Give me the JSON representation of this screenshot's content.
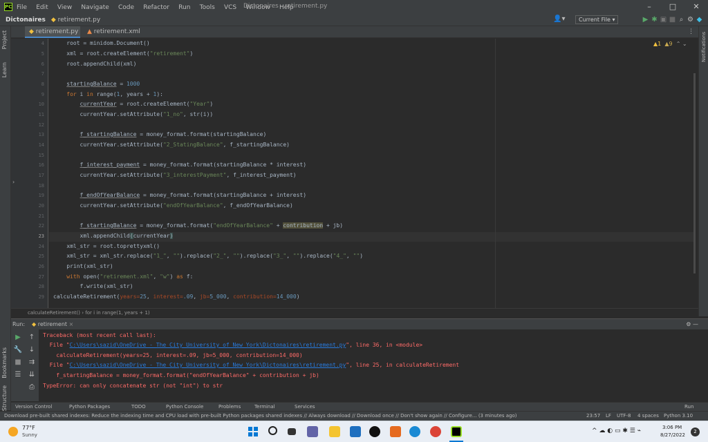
{
  "window": {
    "title": "Dictonaires - retirement.py",
    "menu": [
      "File",
      "Edit",
      "View",
      "Navigate",
      "Code",
      "Refactor",
      "Run",
      "Tools",
      "VCS",
      "Window",
      "Help"
    ],
    "controls": [
      "–",
      "□",
      "✕"
    ]
  },
  "navbar": {
    "project": "Dictonaires",
    "file": "retirement.py",
    "run_config": "Current File ▾"
  },
  "side": {
    "project_label": "Project",
    "learn_label": "Learn",
    "bookmarks_label": "Bookmarks",
    "structure_label": "Structure",
    "notifications_label": "Notifications"
  },
  "tabs": [
    {
      "label": "retirement.py",
      "active": true
    },
    {
      "label": "retirement.xml",
      "active": false
    }
  ],
  "inspection": {
    "warnings": "▲1",
    "weak": "▲9"
  },
  "editor": {
    "current_line": 23,
    "line_numbers": [
      "4",
      "5",
      "6",
      "7",
      "8",
      "9",
      "10",
      "11",
      "12",
      "13",
      "14",
      "15",
      "16",
      "17",
      "18",
      "19",
      "20",
      "21",
      "22",
      "23",
      "24",
      "25",
      "26",
      "27",
      "28",
      "29"
    ]
  },
  "breadcrumb": "calculateRetirement()   ›   for i in range(1, years + 1)",
  "run": {
    "label": "Run:",
    "config": "retirement",
    "console": [
      "Traceback (most recent call last):",
      "  File \"C:\\Users\\sazid\\OneDrive - The City University of New York\\Dictonaires\\retirement.py\", line 36, in <module>",
      "    calculateRetirement(years=25, interest=.09, jb=5_000, contribution=14_000)",
      "  File \"C:\\Users\\sazid\\OneDrive - The City University of New York\\Dictonaires\\retirement.py\", line 25, in calculateRetirement",
      "    f_startingBalance = money_format.format(\"endOfYearBalance\" + contribution + jb)",
      "TypeError: can only concatenate str (not \"int\") to str"
    ]
  },
  "bottom_tabs": [
    "Version Control",
    "Python Packages",
    "TODO",
    "Python Console",
    "Problems",
    "Terminal",
    "Services",
    "Run"
  ],
  "status": {
    "message": "Download pre-built shared indexes: Reduce the indexing time and CPU load with pre-built Python packages shared indexes // Always download // Download once // Don't show again // Configure... (3 minutes ago)",
    "position": "23:57",
    "line_sep": "LF",
    "encoding": "UTF-8",
    "indent": "4 spaces",
    "interpreter": "Python 3.10"
  },
  "taskbar": {
    "weather_temp": "77°F",
    "weather_desc": "Sunny",
    "time": "3:06 PM",
    "date": "8/27/2022",
    "badge": "2"
  }
}
